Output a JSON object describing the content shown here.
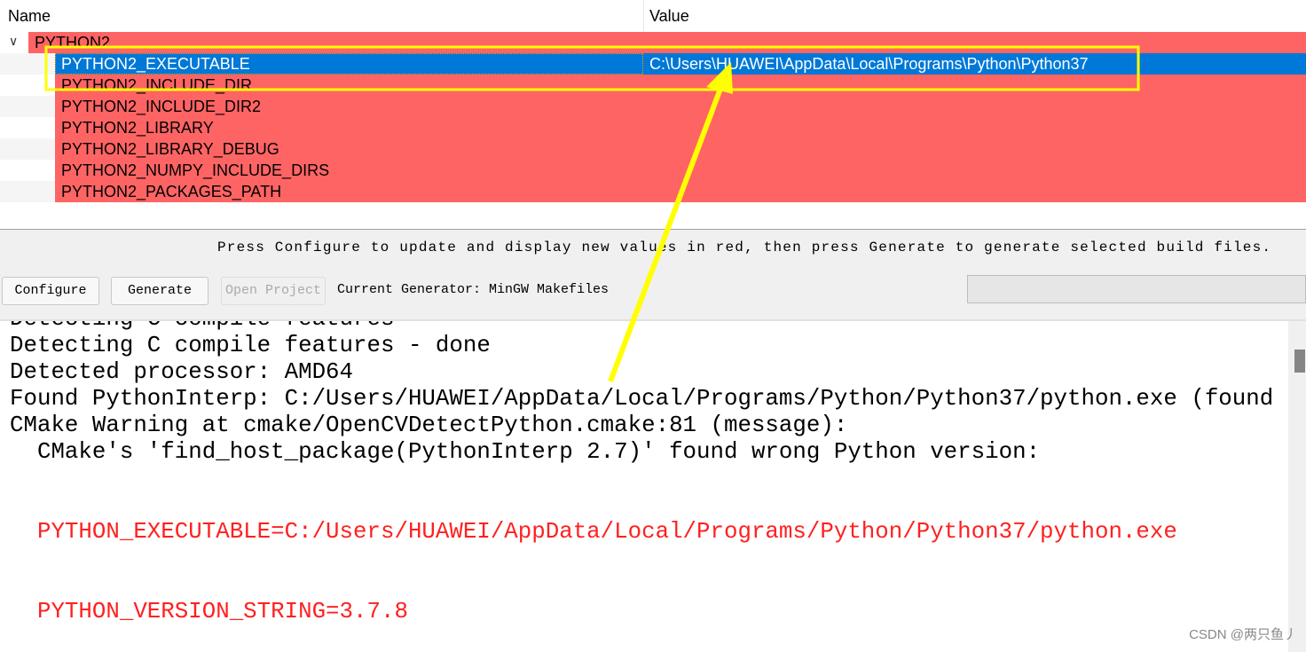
{
  "tree": {
    "columns": {
      "name": "Name",
      "value": "Value"
    },
    "group": {
      "label": "PYTHON2",
      "expanded": true
    },
    "rows": [
      {
        "name": "PYTHON2_EXECUTABLE",
        "value": "C:\\Users\\HUAWEI\\AppData\\Local\\Programs\\Python\\Python37",
        "selected": true
      },
      {
        "name": "PYTHON2_INCLUDE_DIR",
        "value": ""
      },
      {
        "name": "PYTHON2_INCLUDE_DIR2",
        "value": ""
      },
      {
        "name": "PYTHON2_LIBRARY",
        "value": ""
      },
      {
        "name": "PYTHON2_LIBRARY_DEBUG",
        "value": ""
      },
      {
        "name": "PYTHON2_NUMPY_INCLUDE_DIRS",
        "value": ""
      },
      {
        "name": "PYTHON2_PACKAGES_PATH",
        "value": ""
      }
    ]
  },
  "panel": {
    "status": "Press Configure to update and display new values in red, then press Generate to generate selected build files.",
    "configure": "Configure",
    "generate": "Generate",
    "open_project": "Open Project",
    "generator": "Current Generator: MinGW Makefiles"
  },
  "output": {
    "lines": [
      {
        "text": "Detecting C compile features",
        "error": false
      },
      {
        "text": "Detecting C compile features - done",
        "error": false
      },
      {
        "text": "Detected processor: AMD64",
        "error": false
      },
      {
        "text": "Found PythonInterp: C:/Users/HUAWEI/AppData/Local/Programs/Python/Python37/python.exe (found",
        "error": false
      },
      {
        "text": "CMake Warning at cmake/OpenCVDetectPython.cmake:81 (message):",
        "error": false
      },
      {
        "text": "  CMake's 'find_host_package(PythonInterp 2.7)' found wrong Python version:",
        "error": false
      },
      {
        "text": "",
        "error": false
      },
      {
        "text": "",
        "error": false
      },
      {
        "text": "  PYTHON_EXECUTABLE=C:/Users/HUAWEI/AppData/Local/Programs/Python/Python37/python.exe",
        "error": true
      },
      {
        "text": "",
        "error": false
      },
      {
        "text": "",
        "error": false
      },
      {
        "text": "  PYTHON_VERSION_STRING=3.7.8",
        "error": true
      }
    ]
  },
  "colors": {
    "changed_row": "#ff6464",
    "selection": "#0078d7",
    "annotation": "#ffff00",
    "error_text": "#ff2020"
  },
  "watermark": "CSDN @两只鱼丿"
}
